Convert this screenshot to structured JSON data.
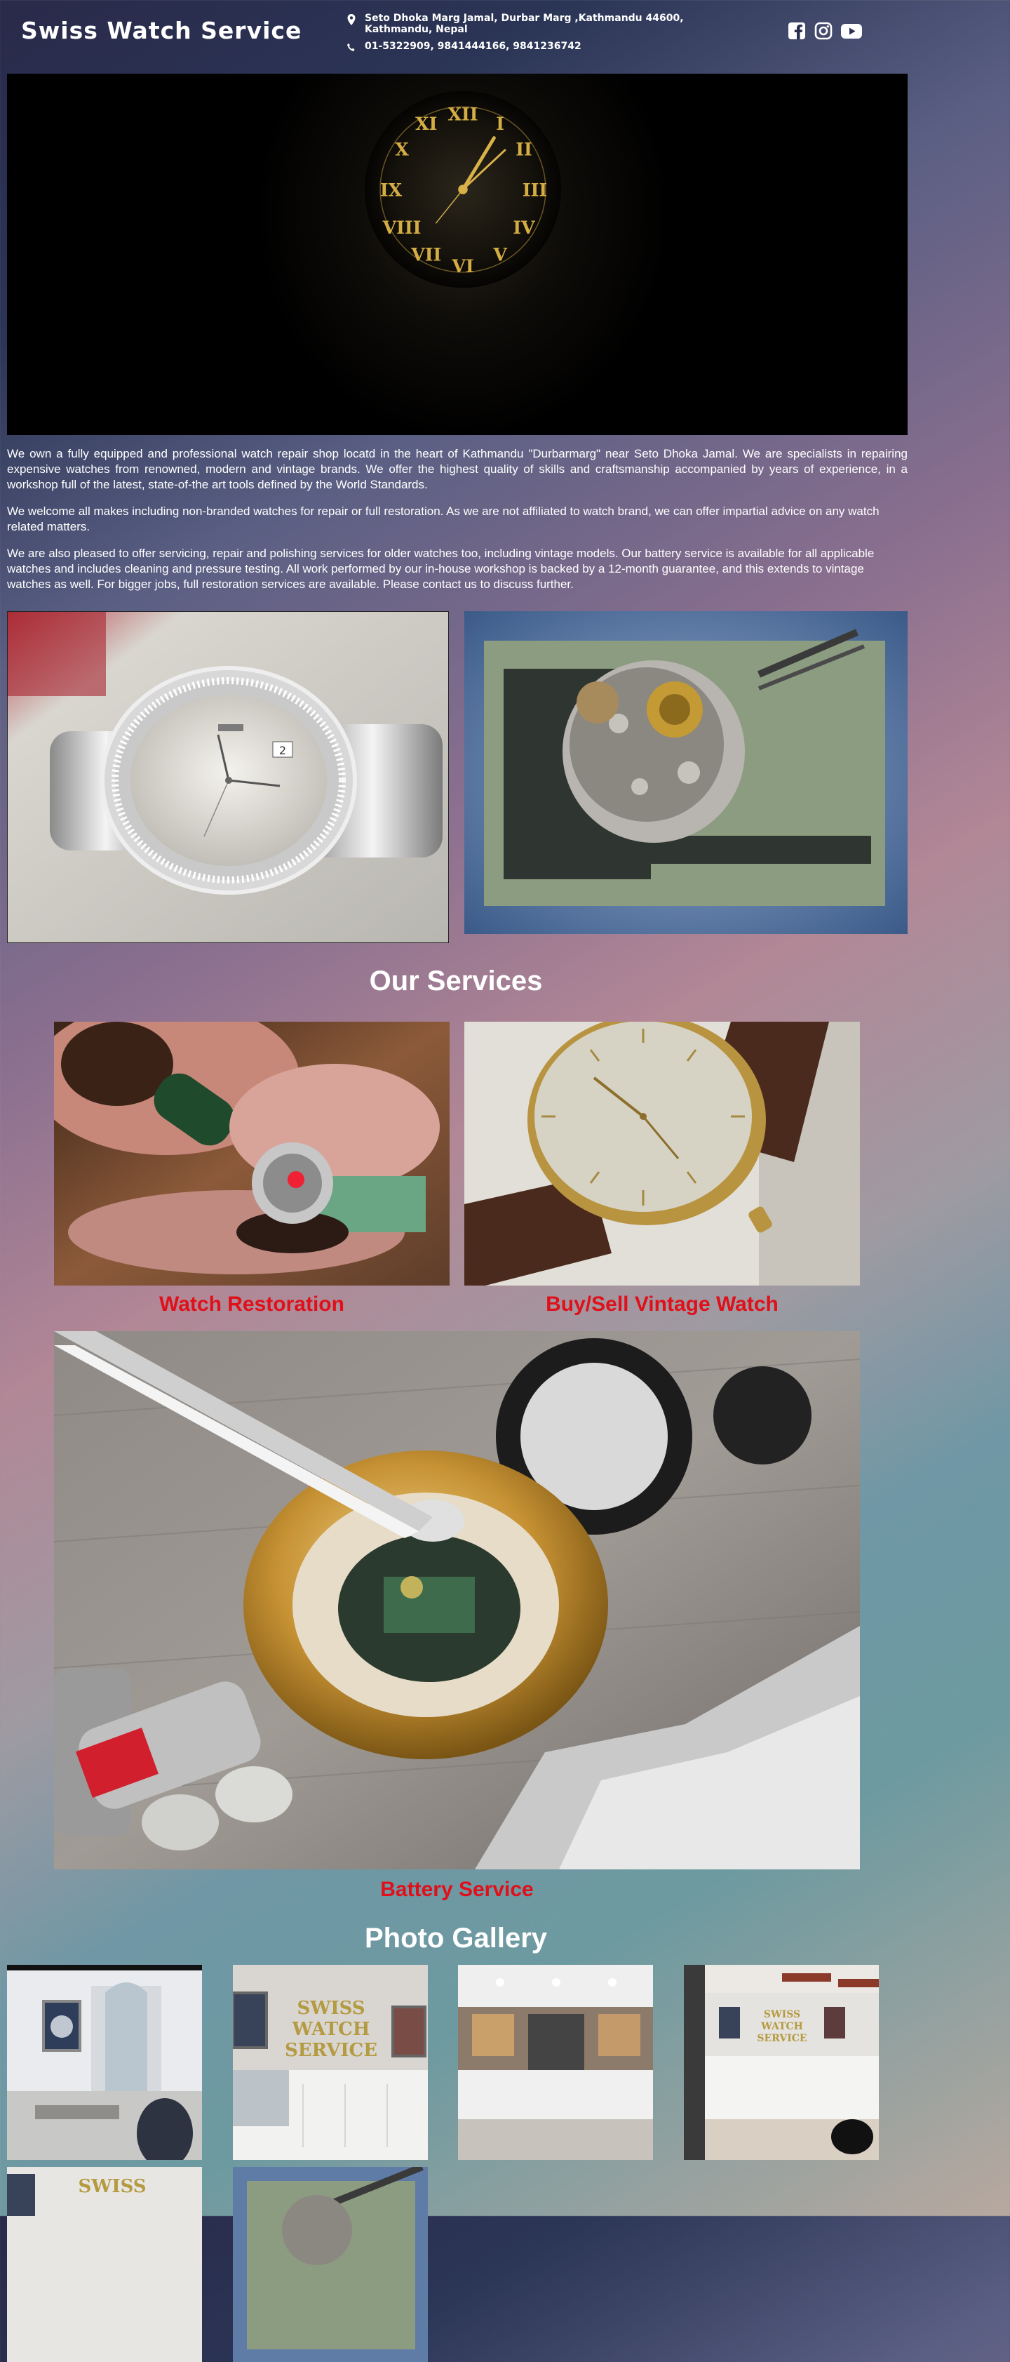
{
  "header": {
    "brand": "Swiss Watch Service",
    "address": "Seto Dhoka Marg Jamal, Durbar Marg ,Kathmandu 44600, Kathmandu, Nepal",
    "phone": "01-5322909, 9841444166, 9841236742",
    "social": [
      "facebook-icon",
      "instagram-icon",
      "youtube-icon"
    ]
  },
  "about": {
    "p1": "We own a fully equipped and professional watch repair shop locatd in the heart of Kathmandu \"Durbarmarg\" near Seto Dhoka Jamal. We are specialists in repairing expensive watches from renowned, modern and vintage brands. We offer the highest quality of skills and craftsmanship accompanied by years of experience, in a workshop full of the latest, state-of-the art tools defined by the World Standards.",
    "p2": "We welcome all makes including non-branded watches for repair or full restoration. As we are not affiliated to watch brand, we can offer impartial advice on any watch related matters.",
    "p3": "We are also pleased to offer servicing, repair and polishing services for older watches too, including vintage models. Our battery service is available for all applicable watches and includes cleaning and pressure testing. All work performed by our in-house workshop is backed by a 12-month guarantee, and this extends to vintage watches as well. For bigger jobs, full restoration services are available. Please contact us to discuss further."
  },
  "services": {
    "title": "Our Services",
    "items": [
      "Watch Restoration",
      "Buy/Sell Vintage Watch",
      "Battery Service"
    ]
  },
  "gallery": {
    "title": "Photo Gallery",
    "sign_text": [
      "SWISS",
      "WATCH",
      "SERVICE"
    ]
  },
  "colors": {
    "accent_red": "#e0101a",
    "clock_gold": "#c8a23c"
  }
}
